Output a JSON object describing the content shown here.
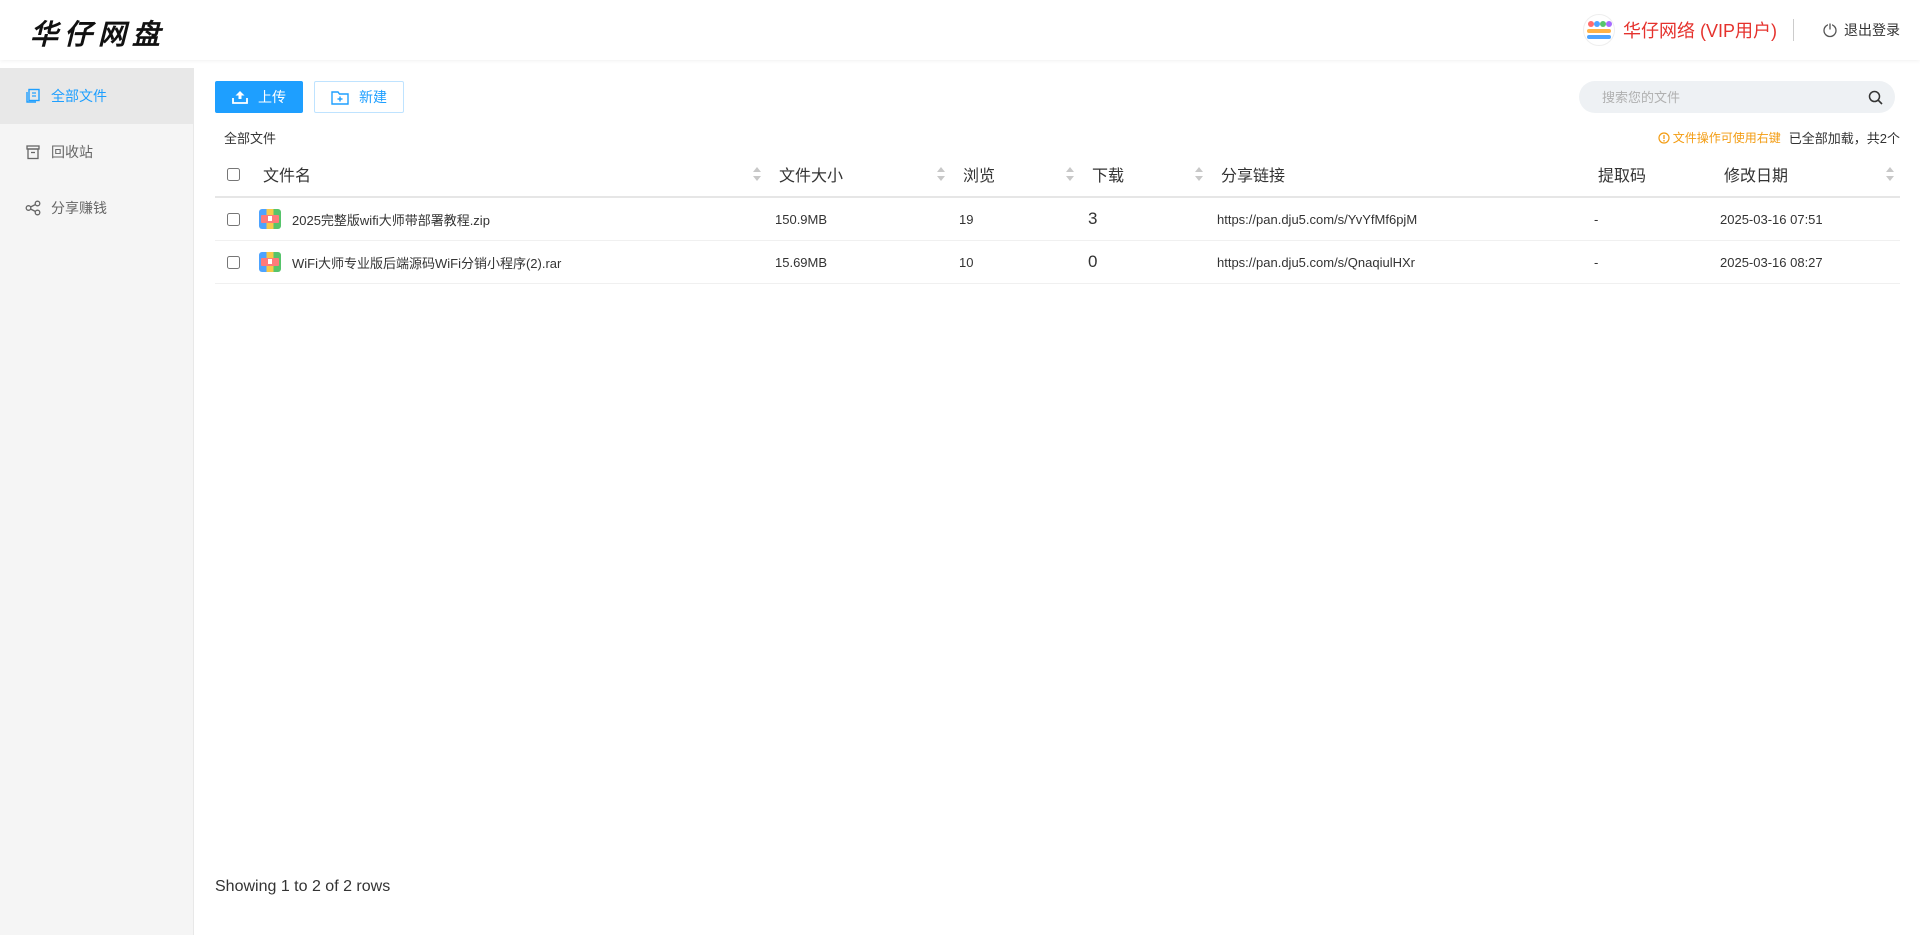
{
  "header": {
    "logo": "华仔网盘",
    "username": "华仔网络 (VIP用户)",
    "logout_label": "退出登录"
  },
  "sidebar": {
    "items": [
      {
        "label": "全部文件",
        "icon": "files-icon",
        "active": true
      },
      {
        "label": "回收站",
        "icon": "trash-icon",
        "active": false
      },
      {
        "label": "分享赚钱",
        "icon": "share-icon",
        "active": false
      }
    ]
  },
  "toolbar": {
    "upload_label": "上传",
    "new_label": "新建"
  },
  "search": {
    "placeholder": "搜索您的文件"
  },
  "breadcrumb": "全部文件",
  "hint": {
    "tip": "文件操作可使用右键",
    "count": "已全部加载，共2个"
  },
  "table": {
    "columns": [
      "文件名",
      "文件大小",
      "浏览",
      "下载",
      "分享链接",
      "提取码",
      "修改日期"
    ],
    "rows": [
      {
        "name": "2025完整版wifi大师带部署教程.zip",
        "size": "150.9MB",
        "views": "19",
        "downloads": "3",
        "share_link": "https://pan.dju5.com/s/YvYfMf6pjM",
        "code": "-",
        "date": "2025-03-16 07:51"
      },
      {
        "name": "WiFi大师专业版后端源码WiFi分销小程序(2).rar",
        "size": "15.69MB",
        "views": "10",
        "downloads": "0",
        "share_link": "https://pan.dju5.com/s/QnaqiulHXr",
        "code": "-",
        "date": "2025-03-16 08:27"
      }
    ]
  },
  "footer": {
    "pagination_text": "Showing 1 to 2 of 2 rows"
  },
  "colors": {
    "accent": "#1e9fff",
    "username": "#e5322d",
    "downloads": "#f39c12"
  }
}
